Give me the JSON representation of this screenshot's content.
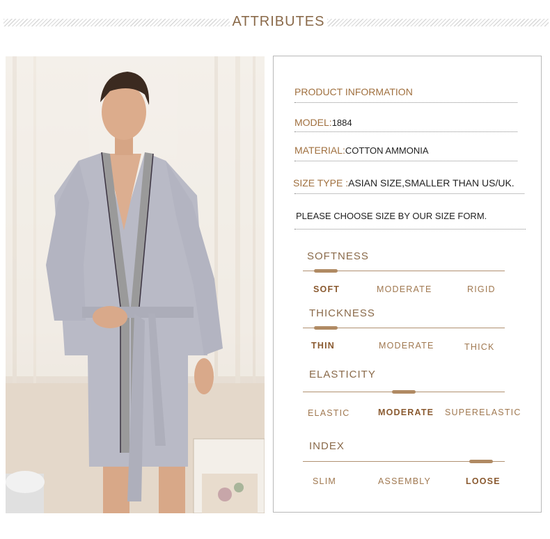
{
  "header": {
    "title": "ATTRIBUTES"
  },
  "product_info": {
    "heading": "PRODUCT INFORMATION",
    "model_label": "MODEL:",
    "model_value": "1884",
    "material_label": "MATERIAL:",
    "material_value": "COTTON AMMONIA",
    "size_type_label": "SIZE TYPE :",
    "size_type_value": "ASIAN SIZE,SMALLER THAN US/UK.",
    "note": "PLEASE CHOOSE SIZE BY OUR SIZE FORM."
  },
  "attributes": [
    {
      "title": "SOFTNESS",
      "options": [
        "SOFT",
        "MODERATE",
        "RIGID"
      ],
      "selected": 0
    },
    {
      "title": "THICKNESS",
      "options": [
        "THIN",
        "MODERATE",
        "THICK"
      ],
      "selected": 0
    },
    {
      "title": "ELASTICITY",
      "options": [
        "ELASTIC",
        "MODERATE",
        "SUPERELASTIC"
      ],
      "selected": 1
    },
    {
      "title": "INDEX",
      "options": [
        "SLIM",
        "ASSEMBLY",
        "LOOSE"
      ],
      "selected": 2
    }
  ],
  "colors": {
    "accent": "#a0703f",
    "knob": "#b08a63",
    "robe": "#b9bac6",
    "trim": "#9a9a9a"
  },
  "photo": {
    "description_icon": "model-wearing-robe-image"
  }
}
